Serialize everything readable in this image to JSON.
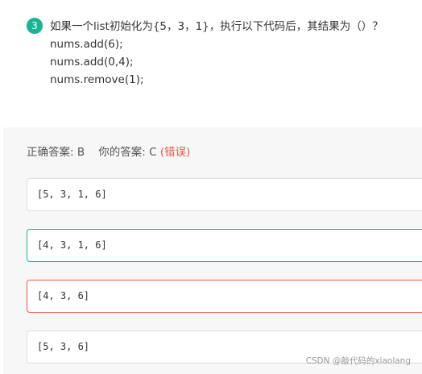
{
  "question": {
    "number": "3",
    "lines": [
      "如果一个list初始化为{5，3，1}，执行以下代码后，其结果为（）？",
      "nums.add(6);",
      "nums.add(0,4);",
      "nums.remove(1);"
    ]
  },
  "answer": {
    "correct_label": "正确答案:",
    "correct_value": "B",
    "yours_label": "你的答案:",
    "yours_value": "C",
    "status": "(错误)"
  },
  "options": [
    {
      "text": "[5, 3, 1, 6]",
      "state": "normal"
    },
    {
      "text": "[4, 3, 1, 6]",
      "state": "correct"
    },
    {
      "text": "[4, 3, 6]",
      "state": "wrong"
    },
    {
      "text": "[5, 3, 6]",
      "state": "normal"
    }
  ],
  "watermark": "CSDN @敲代码的xiaolang",
  "colors": {
    "accent": "#1ab394",
    "error": "#e8594a"
  }
}
